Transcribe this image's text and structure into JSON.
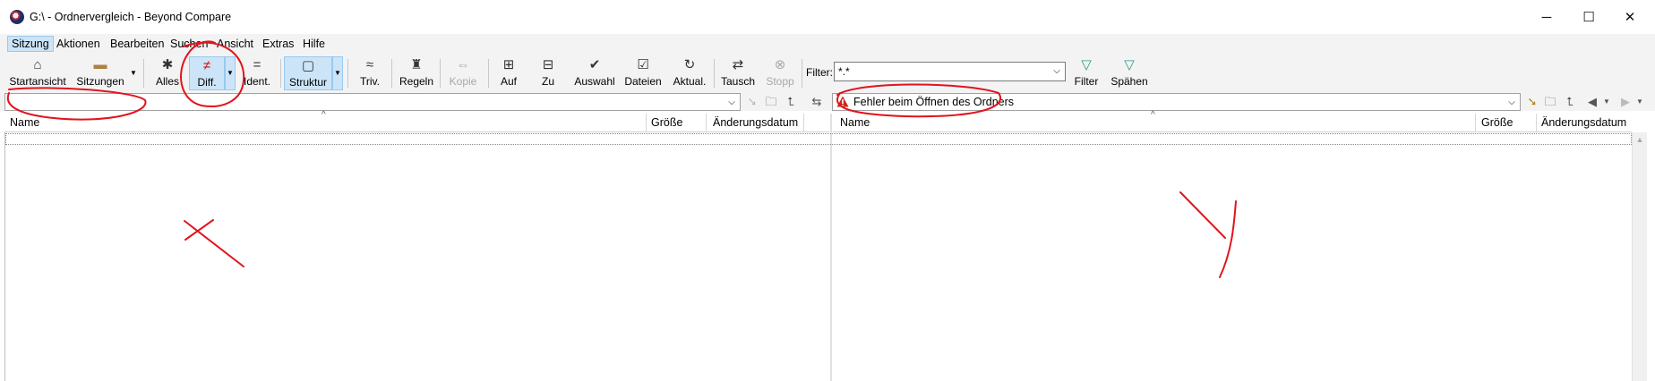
{
  "window": {
    "title": "G:\\ - Ordnervergleich - Beyond Compare",
    "controls": {
      "minimize": "─",
      "maximize": "☐",
      "close": "✕"
    }
  },
  "menu": [
    "Sitzung",
    "Aktionen",
    "Bearbeiten",
    "Suchen",
    "Ansicht",
    "Extras",
    "Hilfe"
  ],
  "toolbar": {
    "startansicht": "Startansicht",
    "sitzungen": "Sitzungen",
    "alles": "Alles",
    "diff": "Diff.",
    "ident": "Ident.",
    "struktur": "Struktur",
    "triv": "Triv.",
    "regeln": "Regeln",
    "kopie": "Kopie",
    "auf": "Auf",
    "zu": "Zu",
    "auswahl": "Auswahl",
    "dateien": "Dateien",
    "aktual": "Aktual.",
    "tausch": "Tausch",
    "stopp": "Stopp",
    "filter_label": "Filter:",
    "filter_value": "*.*",
    "filter_button": "Filter",
    "spaehen": "Spähen"
  },
  "left_pane": {
    "path": "",
    "columns": {
      "name": "Name",
      "size": "Größe",
      "date": "Änderungsdatum"
    }
  },
  "right_pane": {
    "path": "Fehler beim Öffnen des Ordners",
    "columns": {
      "name": "Name",
      "size": "Größe",
      "date": "Änderungsdatum"
    }
  },
  "colors": {
    "pressed_bg": "#cce4f7",
    "annotation_red": "#e0141e",
    "warning_red": "#c42b1c"
  }
}
